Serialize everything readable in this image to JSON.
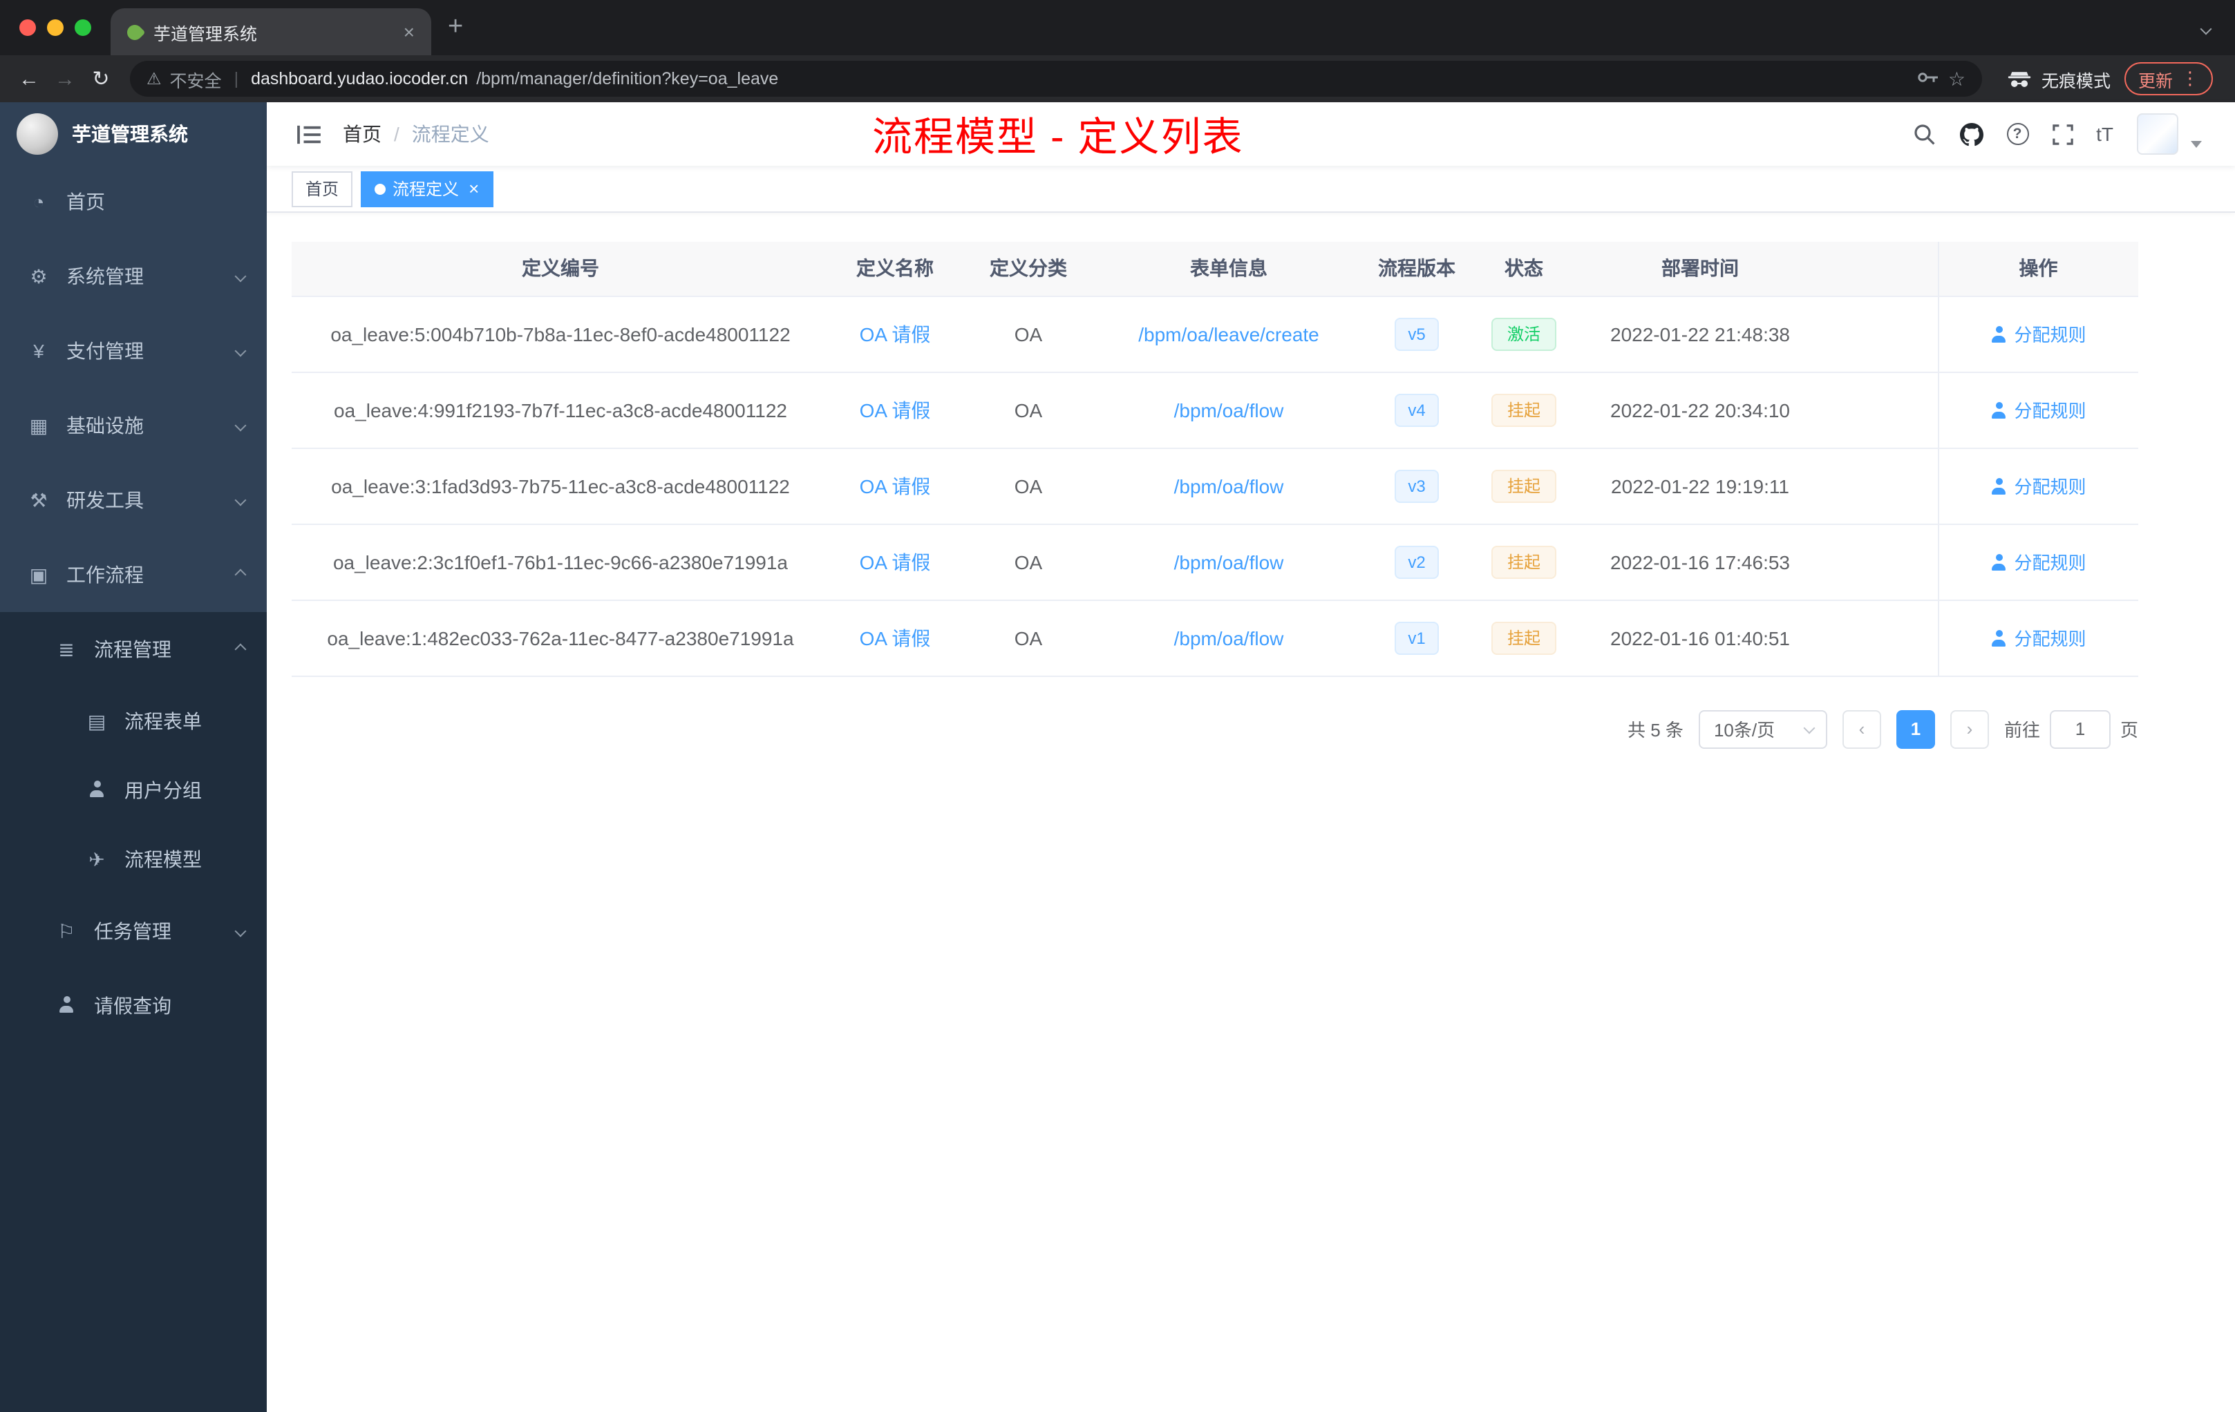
{
  "browser": {
    "tab_title": "芋道管理系统",
    "security_label": "不安全",
    "url_host": "dashboard.yudao.iocoder.cn",
    "url_path": "/bpm/manager/definition?key=oa_leave",
    "incognito_label": "无痕模式",
    "update_label": "更新"
  },
  "sidebar": {
    "logo_title": "芋道管理系统",
    "items": [
      {
        "label": "首页",
        "icon": "dashboard-icon"
      },
      {
        "label": "系统管理",
        "icon": "gear-icon",
        "arrow": "down"
      },
      {
        "label": "支付管理",
        "icon": "yen-icon",
        "arrow": "down"
      },
      {
        "label": "基础设施",
        "icon": "infrastructure-icon",
        "arrow": "down"
      },
      {
        "label": "研发工具",
        "icon": "dev-tools-icon",
        "arrow": "down"
      },
      {
        "label": "工作流程",
        "icon": "workflow-icon",
        "arrow": "up"
      }
    ],
    "submenu": {
      "process_mgmt": {
        "label": "流程管理",
        "icon": "list-icon",
        "arrow": "up"
      },
      "process_children": [
        {
          "label": "流程表单",
          "icon": "form-icon"
        },
        {
          "label": "用户分组",
          "icon": "user-group-icon"
        },
        {
          "label": "流程模型",
          "icon": "paper-plane-icon"
        }
      ],
      "task_mgmt": {
        "label": "任务管理",
        "icon": "flag-icon",
        "arrow": "down"
      },
      "leave_query": {
        "label": "请假查询",
        "icon": "person-icon"
      }
    }
  },
  "header": {
    "breadcrumb": [
      "首页",
      "流程定义"
    ],
    "annotation": "流程模型 - 定义列表"
  },
  "tags": [
    {
      "label": "首页",
      "active": false
    },
    {
      "label": "流程定义",
      "active": true
    }
  ],
  "table": {
    "columns": [
      "定义编号",
      "定义名称",
      "定义分类",
      "表单信息",
      "流程版本",
      "状态",
      "部署时间",
      "操作"
    ],
    "action_label": "分配规则",
    "rows": [
      {
        "id": "oa_leave:5:004b710b-7b8a-11ec-8ef0-acde48001122",
        "name": "OA 请假",
        "category": "OA",
        "form": "/bpm/oa/leave/create",
        "version": "v5",
        "status": "激活",
        "status_type": "success",
        "time": "2022-01-22 21:48:38"
      },
      {
        "id": "oa_leave:4:991f2193-7b7f-11ec-a3c8-acde48001122",
        "name": "OA 请假",
        "category": "OA",
        "form": "/bpm/oa/flow",
        "version": "v4",
        "status": "挂起",
        "status_type": "warning",
        "time": "2022-01-22 20:34:10"
      },
      {
        "id": "oa_leave:3:1fad3d93-7b75-11ec-a3c8-acde48001122",
        "name": "OA 请假",
        "category": "OA",
        "form": "/bpm/oa/flow",
        "version": "v3",
        "status": "挂起",
        "status_type": "warning",
        "time": "2022-01-22 19:19:11"
      },
      {
        "id": "oa_leave:2:3c1f0ef1-76b1-11ec-9c66-a2380e71991a",
        "name": "OA 请假",
        "category": "OA",
        "form": "/bpm/oa/flow",
        "version": "v2",
        "status": "挂起",
        "status_type": "warning",
        "time": "2022-01-16 17:46:53"
      },
      {
        "id": "oa_leave:1:482ec033-762a-11ec-8477-a2380e71991a",
        "name": "OA 请假",
        "category": "OA",
        "form": "/bpm/oa/flow",
        "version": "v1",
        "status": "挂起",
        "status_type": "warning",
        "time": "2022-01-16 01:40:51"
      }
    ]
  },
  "pagination": {
    "total": "共 5 条",
    "page_size": "10条/页",
    "current_page": "1",
    "goto_label": "前往",
    "goto_value": "1",
    "page_suffix": "页"
  },
  "colors": {
    "accent": "#409eff",
    "success": "#13ce66",
    "warning": "#e6a23c",
    "annotation_red": "#fd0100",
    "sidebar_bg": "#304156",
    "submenu_bg": "#1f2d3d"
  }
}
